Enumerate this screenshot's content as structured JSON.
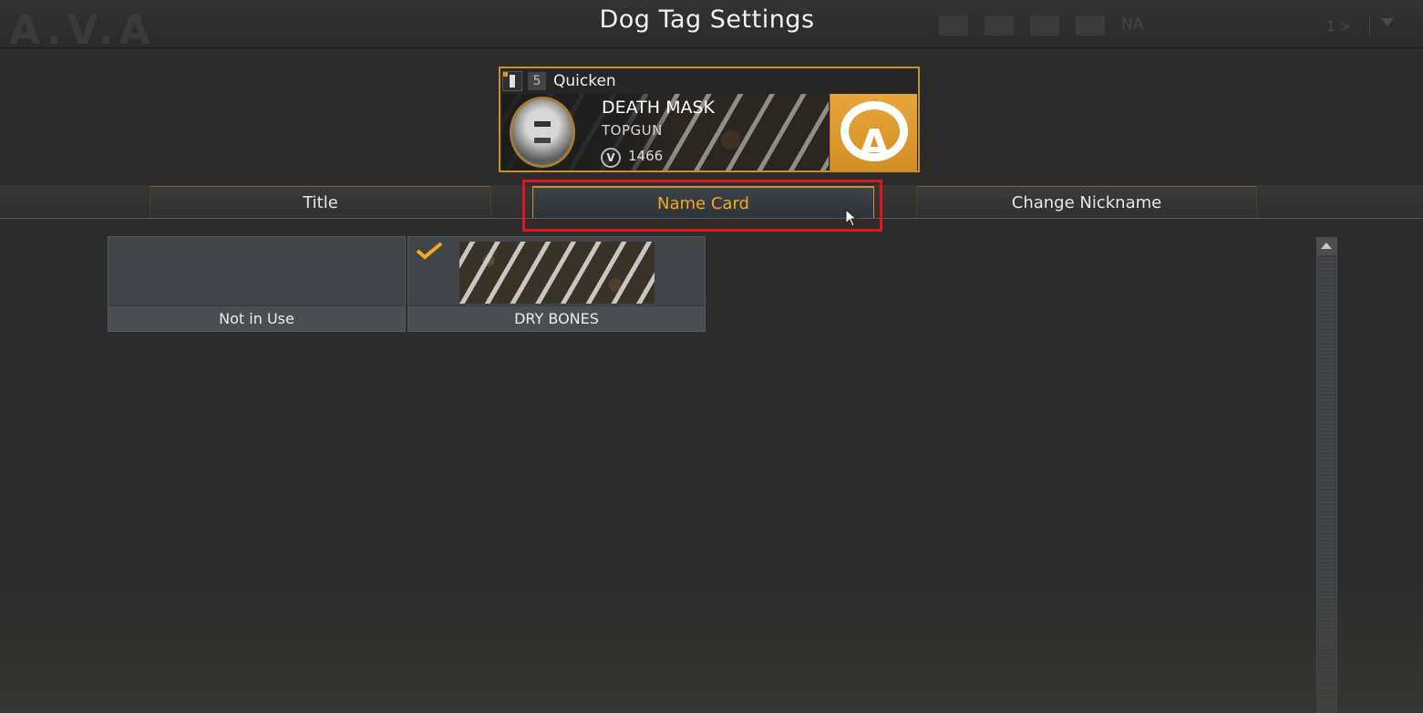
{
  "header": {
    "title": "Dog Tag Settings",
    "ghost_logo": "A.V.A",
    "region": "NA",
    "page_indicator": "1 >"
  },
  "dog_tag": {
    "level": "5",
    "player_name": "Quicken",
    "name_card_title": "DEATH MASK",
    "name_card_subtitle": "TOPGUN",
    "v_label": "V",
    "points": "1466",
    "clan_letter": "A"
  },
  "tabs": [
    {
      "label": "Title"
    },
    {
      "label": "Name Card",
      "active": true
    },
    {
      "label": "Change Nickname"
    }
  ],
  "items": [
    {
      "label": "Not in Use",
      "selected": false
    },
    {
      "label": "DRY BONES",
      "selected": true
    }
  ],
  "colors": {
    "accent": "#f3a81e",
    "highlight_box": "#e0141a",
    "clan_badge": "#e0a030"
  }
}
